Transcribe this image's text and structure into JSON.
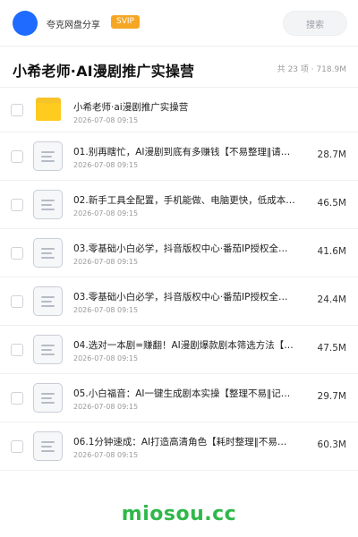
{
  "header": {
    "username": "夸克网盘分享",
    "badge": "SVIP",
    "search_label": "搜索"
  },
  "share": {
    "title": "小希老师·AI漫剧推广实操营",
    "meta": "共 23 项 · 718.9M"
  },
  "files": [
    {
      "type": "folder",
      "name": "小希老师·ai漫剧推广实操营",
      "date": "2026-07-08 09:15",
      "size": ""
    },
    {
      "type": "doc",
      "name": "01.别再瞎忙，AI漫剧到底有多赚钱【不易整理‖请…",
      "date": "2026-07-08 09:15",
      "size": "28.7M"
    },
    {
      "type": "doc",
      "name": "02.新手工具全配置，手机能做、电脑更快，低成本实…",
      "date": "2026-07-08 09:15",
      "size": "46.5M"
    },
    {
      "type": "doc",
      "name": "03.零基础小白必学，抖音版权中心·番茄IP授权全…",
      "date": "2026-07-08 09:15",
      "size": "41.6M"
    },
    {
      "type": "doc",
      "name": "03.零基础小白必学，抖音版权中心·番茄IP授权全…",
      "date": "2026-07-08 09:15",
      "size": "24.4M"
    },
    {
      "type": "doc",
      "name": "04.选对一本剧=赚翻！AI漫剧爆款剧本筛选方法【…",
      "date": "2026-07-08 09:15",
      "size": "47.5M"
    },
    {
      "type": "doc",
      "name": "05.小白福音：AI一键生成剧本实操【整理不易‖记…",
      "date": "2026-07-08 09:15",
      "size": "29.7M"
    },
    {
      "type": "doc",
      "name": "06.1分钟速成：AI打造高清角色【耗时整理‖不易…",
      "date": "2026-07-08 09:15",
      "size": "60.3M"
    }
  ],
  "watermark": "miosou.cc",
  "colors": {
    "avatar": "#1f6bff",
    "svip_badge": "#f5a623",
    "folder": "#ffcb1f",
    "watermark": "#2fb84a"
  },
  "icons": {
    "folder": "folder-icon",
    "document": "document-icon"
  }
}
